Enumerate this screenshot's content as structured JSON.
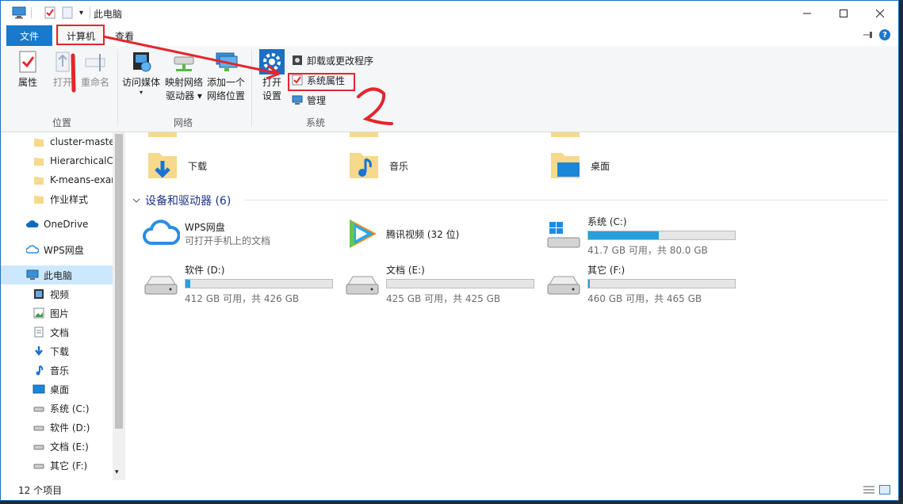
{
  "window": {
    "title": "此电脑"
  },
  "tabs": {
    "file": "文件",
    "computer": "计算机",
    "view": "查看"
  },
  "ribbon": {
    "location": {
      "label": "位置",
      "properties": "属性",
      "open": "打开",
      "rename": "重命名"
    },
    "network": {
      "label": "网络",
      "access_media": "访问媒体",
      "map_drive_1": "映射网络",
      "map_drive_2": "驱动器",
      "add_location_1": "添加一个",
      "add_location_2": "网络位置"
    },
    "system": {
      "label": "系统",
      "open_settings_1": "打开",
      "open_settings_2": "设置",
      "uninstall": "卸载或更改程序",
      "system_properties": "系统属性",
      "manage": "管理"
    }
  },
  "nav": {
    "items": [
      {
        "label": "cluster-maste",
        "icon": "folder-icon"
      },
      {
        "label": "HierarchicalCl",
        "icon": "folder-icon"
      },
      {
        "label": "K-means-exar",
        "icon": "folder-icon"
      },
      {
        "label": "作业样式",
        "icon": "folder-icon"
      },
      {
        "label": "OneDrive",
        "icon": "onedrive-icon"
      },
      {
        "label": "WPS网盘",
        "icon": "wps-cloud-icon"
      },
      {
        "label": "此电脑",
        "icon": "this-pc-icon"
      },
      {
        "label": "视频",
        "icon": "video-icon"
      },
      {
        "label": "图片",
        "icon": "pictures-icon"
      },
      {
        "label": "文档",
        "icon": "documents-icon"
      },
      {
        "label": "下载",
        "icon": "downloads-icon"
      },
      {
        "label": "音乐",
        "icon": "music-icon"
      },
      {
        "label": "桌面",
        "icon": "desktop-icon"
      },
      {
        "label": "系统 (C:)",
        "icon": "drive-icon"
      },
      {
        "label": "软件 (D:)",
        "icon": "drive-icon"
      },
      {
        "label": "文档 (E:)",
        "icon": "drive-icon"
      },
      {
        "label": "其它 (F:)",
        "icon": "drive-icon"
      }
    ]
  },
  "content": {
    "folders": {
      "downloads": "下载",
      "music": "音乐",
      "desktop": "桌面"
    },
    "devices_header": "设备和驱动器 (6)",
    "wps": {
      "name": "WPS网盘",
      "subtitle": "可打开手机上的文档"
    },
    "tencent": {
      "name": "腾讯视频 (32 位)"
    },
    "drives": [
      {
        "name": "系统 (C:)",
        "free": "41.7 GB 可用，共 80.0 GB",
        "used_fraction": 0.48
      },
      {
        "name": "软件 (D:)",
        "free": "412 GB 可用，共 426 GB",
        "used_fraction": 0.03
      },
      {
        "name": "文档 (E:)",
        "free": "425 GB 可用，共 425 GB",
        "used_fraction": 0.0
      },
      {
        "name": "其它 (F:)",
        "free": "460 GB 可用，共 465 GB",
        "used_fraction": 0.01
      }
    ]
  },
  "status": {
    "count": "12 个项目"
  },
  "colors": {
    "accent": "#1979ca",
    "annotation": "#e3262d",
    "drive_fill": "#26a0da",
    "selection": "#cce8ff"
  }
}
